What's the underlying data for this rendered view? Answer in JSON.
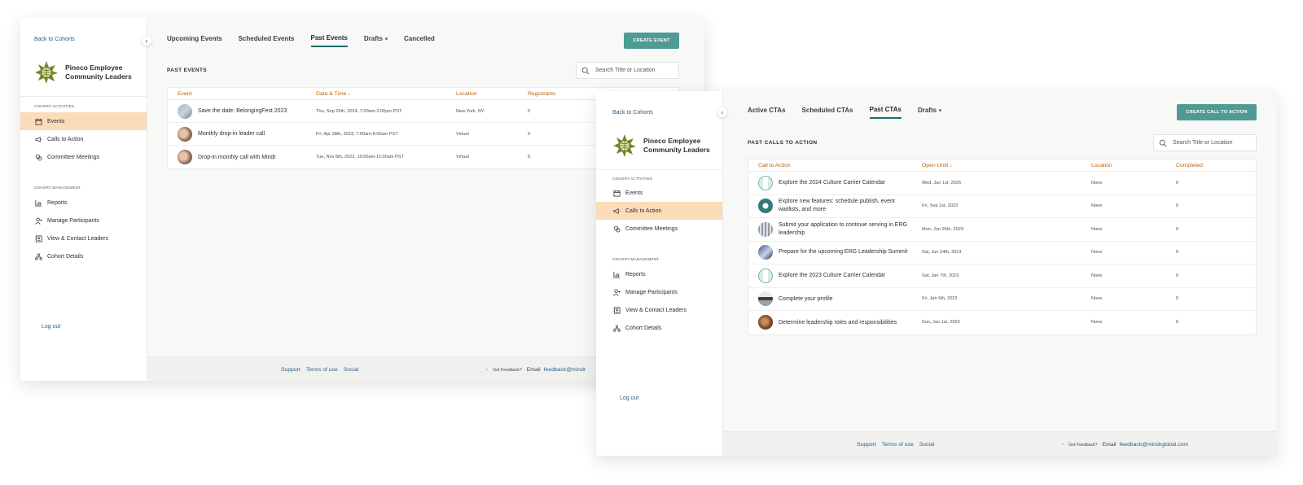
{
  "window1": {
    "sidebar": {
      "back": "Back to Cohorts",
      "org_name": "Pineco Employee Community Leaders",
      "section_activities": "COHORT ACTIVITIES",
      "section_management": "COHORT MANAGEMENT",
      "items": [
        "Events",
        "Calls to Action",
        "Committee Meetings"
      ],
      "mgmt_items": [
        "Reports",
        "Manage Participants",
        "View & Contact Leaders",
        "Cohort Details"
      ],
      "logout": "Log out"
    },
    "tabs": [
      "Upcoming Events",
      "Scheduled Events",
      "Past Events",
      "Drafts",
      "Cancelled"
    ],
    "create_button": "CREATE EVENT",
    "section_title": "PAST EVENTS",
    "search_placeholder": "Search Title or Location",
    "table": {
      "headers": [
        "Event",
        "Date & Time ↓",
        "Location",
        "Registrants"
      ],
      "rows": [
        {
          "event": "Save the date: BelongingFest 2023",
          "date": "Thu, Sep 26th, 2024, 7:00am-2:00pm PST",
          "location": "New York, NY",
          "registrants": "0"
        },
        {
          "event": "Monthly drop-in leader call",
          "date": "Fri, Apr 28th, 2023, 7:00am-8:00am PST",
          "location": "Virtual",
          "registrants": "0"
        },
        {
          "event": "Drop-in monthly call with Mindr",
          "date": "Tue, Nov 8th, 2022, 10:00am-11:00am PST",
          "location": "Virtual",
          "registrants": "0"
        }
      ]
    },
    "footer": {
      "support": "Support",
      "terms": "Terms of use",
      "social": "Social",
      "feedback": "Got Feedback?",
      "email_label": "Email",
      "email": "feedback@mindr"
    }
  },
  "window2": {
    "sidebar": {
      "back": "Back to Cohorts",
      "org_name": "Pineco Employee Community Leaders",
      "section_activities": "COHORT ACTIVITIES",
      "section_management": "COHORT MANAGEMENT",
      "items": [
        "Events",
        "Calls to Action",
        "Committee Meetings"
      ],
      "mgmt_items": [
        "Reports",
        "Manage Participants",
        "View & Contact Leaders",
        "Cohort Details"
      ],
      "logout": "Log out"
    },
    "tabs": [
      "Active CTAs",
      "Scheduled CTAs",
      "Past CTAs",
      "Drafts"
    ],
    "create_button": "CREATE CALL TO ACTION",
    "section_title": "PAST CALLS TO ACTION",
    "search_placeholder": "Search Title or Location",
    "table": {
      "headers": [
        "Call to Action",
        "Open Until ↓",
        "Location",
        "Completed"
      ],
      "rows": [
        {
          "title": "Explore the 2024 Culture Carrier Calendar",
          "date": "Wed, Jan 1st, 2025",
          "location": "None",
          "completed": "0"
        },
        {
          "title": "Explore new features: schedule publish, event waitlists, and more",
          "date": "Fri, Sep 1st, 2023",
          "location": "None",
          "completed": "0"
        },
        {
          "title": "Submit your application to continue serving in ERG leadership",
          "date": "Mon, Jun 26th, 2023",
          "location": "None",
          "completed": "0"
        },
        {
          "title": "Prepare for the upcoming ERG Leadership Summit",
          "date": "Sat, Jun 24th, 2023",
          "location": "None",
          "completed": "0"
        },
        {
          "title": "Explore the 2023 Culture Carrier Calendar",
          "date": "Sat, Jan 7th, 2023",
          "location": "None",
          "completed": "0"
        },
        {
          "title": "Complete your profile",
          "date": "Fri, Jan 6th, 2023",
          "location": "None",
          "completed": "0"
        },
        {
          "title": "Determine leadership roles and responsibilities",
          "date": "Sun, Jan 1st, 2023",
          "location": "None",
          "completed": "0"
        }
      ]
    },
    "footer": {
      "support": "Support",
      "terms": "Terms of use",
      "social": "Social",
      "feedback": "Got Feedback?",
      "email_label": "Email",
      "email": "feedback@mindrglobal.com"
    }
  },
  "colors": {
    "accent": "#4e9b94",
    "active_nav": "#fbdcb8",
    "header_text": "#b8620f",
    "link": "#2a5f86"
  }
}
